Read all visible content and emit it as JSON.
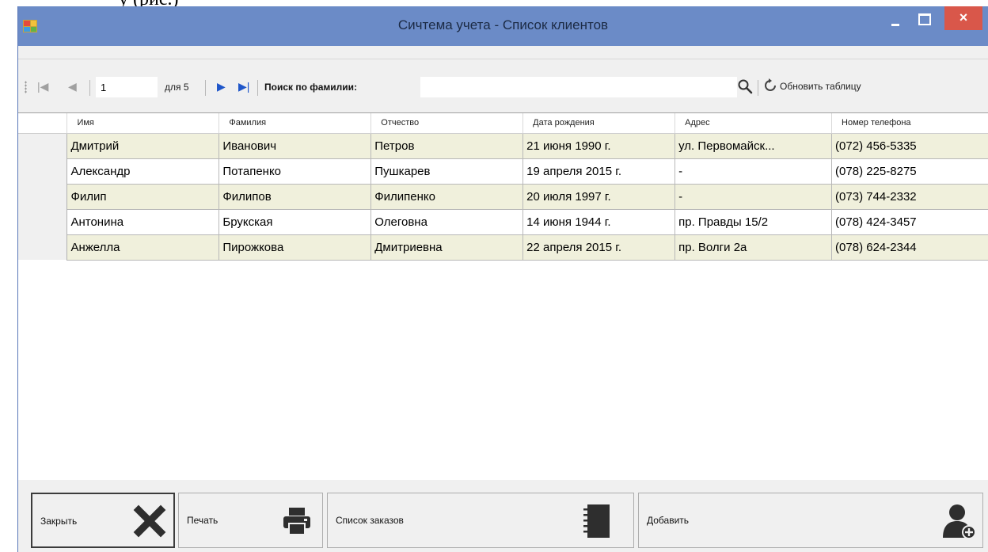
{
  "window": {
    "title": "Сичтема учета - Список клиентов",
    "close_glyph": "×"
  },
  "navigator": {
    "position": "1",
    "count_label": "для 5",
    "search_label": "Поиск по фамилии:",
    "search_value": "",
    "refresh_label": "Обновить таблицу"
  },
  "table": {
    "columns": [
      "Имя",
      "Фамилия",
      "Отчество",
      "Дата рождения",
      "Адрес",
      "Номер телефона"
    ],
    "rows": [
      [
        "Дмитрий",
        "Иванович",
        "Петров",
        "21 июня 1990 г.",
        "ул. Первомайск...",
        "(072) 456-5335"
      ],
      [
        "Александр",
        "Потапенко",
        "Пушкарев",
        "19 апреля 2015 г.",
        "-",
        "(078) 225-8275"
      ],
      [
        "Филип",
        "Филипов",
        "Филипенко",
        "20 июля 1997 г.",
        "-",
        "(073) 744-2332"
      ],
      [
        "Антонина",
        "Брукская",
        "Олеговна",
        "14 июня 1944 г.",
        "пр. Правды 15/2",
        "(078) 424-3457"
      ],
      [
        "Анжелла",
        "Пирожкова",
        "Дмитриевна",
        "22 апреля 2015 г.",
        "пр. Волги 2а",
        "(078) 624-2344"
      ]
    ]
  },
  "buttons": {
    "close": "Закрыть",
    "print": "Печать",
    "orders": "Список заказов",
    "add": "Добавить"
  },
  "icons": {
    "first": "move-first-icon",
    "prev": "move-previous-icon",
    "next": "move-next-icon",
    "last": "move-last-icon",
    "search": "search-icon",
    "refresh": "refresh-icon",
    "close": "close-x-icon",
    "print": "printer-icon",
    "orders": "notebook-icon",
    "add": "add-user-icon"
  },
  "colors": {
    "titlebar": "#6b8bc7",
    "close_button": "#d9574a",
    "alt_row": "#f0f0dc",
    "nav_active": "#1f56c9"
  }
}
